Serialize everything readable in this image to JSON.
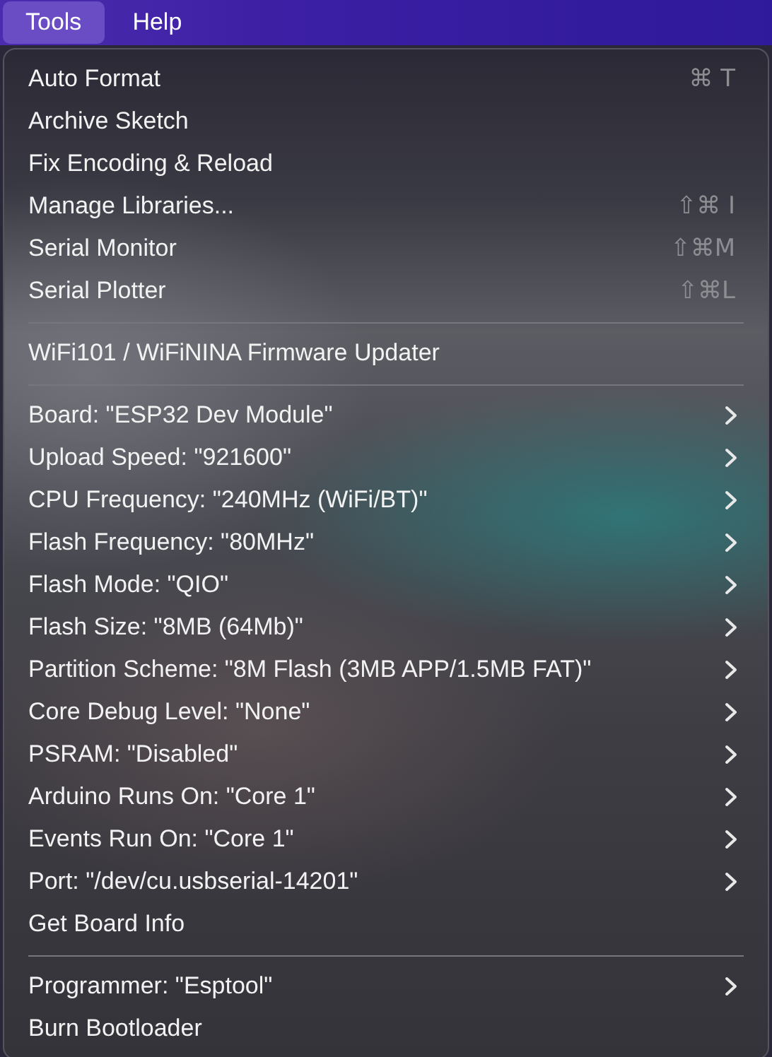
{
  "menubar": [
    {
      "label": "Tools",
      "selected": true
    },
    {
      "label": "Help",
      "selected": false
    }
  ],
  "menu": {
    "items": [
      {
        "kind": "item",
        "label": "Auto Format",
        "shortcut": "⌘ T",
        "has_submenu": false
      },
      {
        "kind": "item",
        "label": "Archive Sketch",
        "has_submenu": false
      },
      {
        "kind": "item",
        "label": "Fix Encoding & Reload",
        "has_submenu": false
      },
      {
        "kind": "item",
        "label": "Manage Libraries...",
        "shortcut": "⇧⌘ I",
        "has_submenu": false
      },
      {
        "kind": "item",
        "label": "Serial Monitor",
        "shortcut": "⇧⌘M",
        "has_submenu": false
      },
      {
        "kind": "item",
        "label": "Serial Plotter",
        "shortcut": "⇧⌘L",
        "has_submenu": false
      },
      {
        "kind": "separator"
      },
      {
        "kind": "item",
        "label": "WiFi101 / WiFiNINA Firmware Updater",
        "has_submenu": false
      },
      {
        "kind": "separator"
      },
      {
        "kind": "item",
        "label": "Board: \"ESP32 Dev Module\"",
        "has_submenu": true
      },
      {
        "kind": "item",
        "label": "Upload Speed: \"921600\"",
        "has_submenu": true
      },
      {
        "kind": "item",
        "label": "CPU Frequency: \"240MHz (WiFi/BT)\"",
        "has_submenu": true
      },
      {
        "kind": "item",
        "label": "Flash Frequency: \"80MHz\"",
        "has_submenu": true
      },
      {
        "kind": "item",
        "label": "Flash Mode: \"QIO\"",
        "has_submenu": true
      },
      {
        "kind": "item",
        "label": "Flash Size: \"8MB (64Mb)\"",
        "has_submenu": true
      },
      {
        "kind": "item",
        "label": "Partition Scheme: \"8M Flash (3MB APP/1.5MB FAT)\"",
        "has_submenu": true
      },
      {
        "kind": "item",
        "label": "Core Debug Level: \"None\"",
        "has_submenu": true
      },
      {
        "kind": "item",
        "label": "PSRAM: \"Disabled\"",
        "has_submenu": true
      },
      {
        "kind": "item",
        "label": "Arduino Runs On: \"Core 1\"",
        "has_submenu": true
      },
      {
        "kind": "item",
        "label": "Events Run On: \"Core 1\"",
        "has_submenu": true
      },
      {
        "kind": "item",
        "label": "Port: \"/dev/cu.usbserial-14201\"",
        "has_submenu": true
      },
      {
        "kind": "item",
        "label": "Get Board Info",
        "has_submenu": false
      },
      {
        "kind": "separator"
      },
      {
        "kind": "item",
        "label": "Programmer: \"Esptool\"",
        "has_submenu": true
      },
      {
        "kind": "item",
        "label": "Burn Bootloader",
        "has_submenu": false
      }
    ]
  }
}
